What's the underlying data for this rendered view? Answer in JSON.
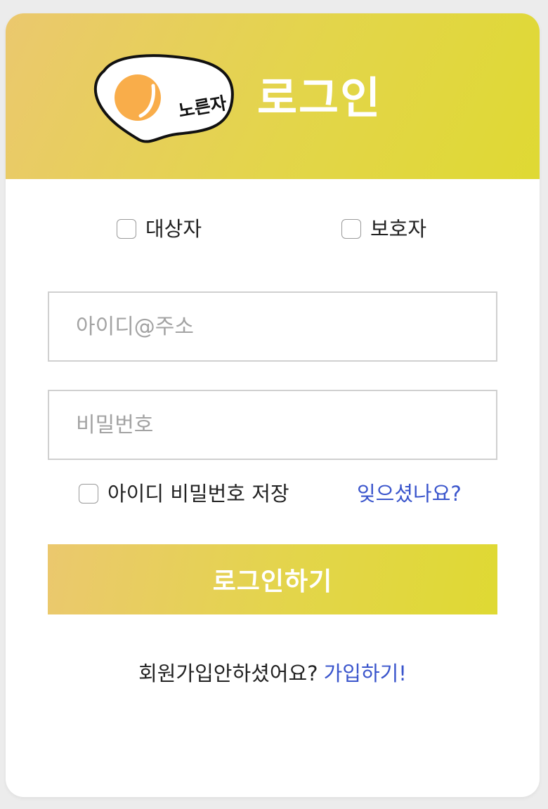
{
  "header": {
    "logo_text": "노른자",
    "title": "로그인"
  },
  "roles": [
    {
      "label": "대상자",
      "checked": false
    },
    {
      "label": "보호자",
      "checked": false
    }
  ],
  "form": {
    "id_placeholder": "아이디@주소",
    "id_value": "",
    "password_placeholder": "비밀번호",
    "password_value": "",
    "save_label": "아이디 비밀번호 저장",
    "forgot_link": "잊으셨나요?",
    "submit_label": "로그인하기"
  },
  "signup": {
    "prompt": "회원가입안하셨어요?",
    "link": "가입하기!"
  },
  "colors": {
    "gradient_start": "#ebc86e",
    "gradient_end": "#dfd933",
    "link": "#3a55cc",
    "logo_circle": "#f9ad4a"
  }
}
